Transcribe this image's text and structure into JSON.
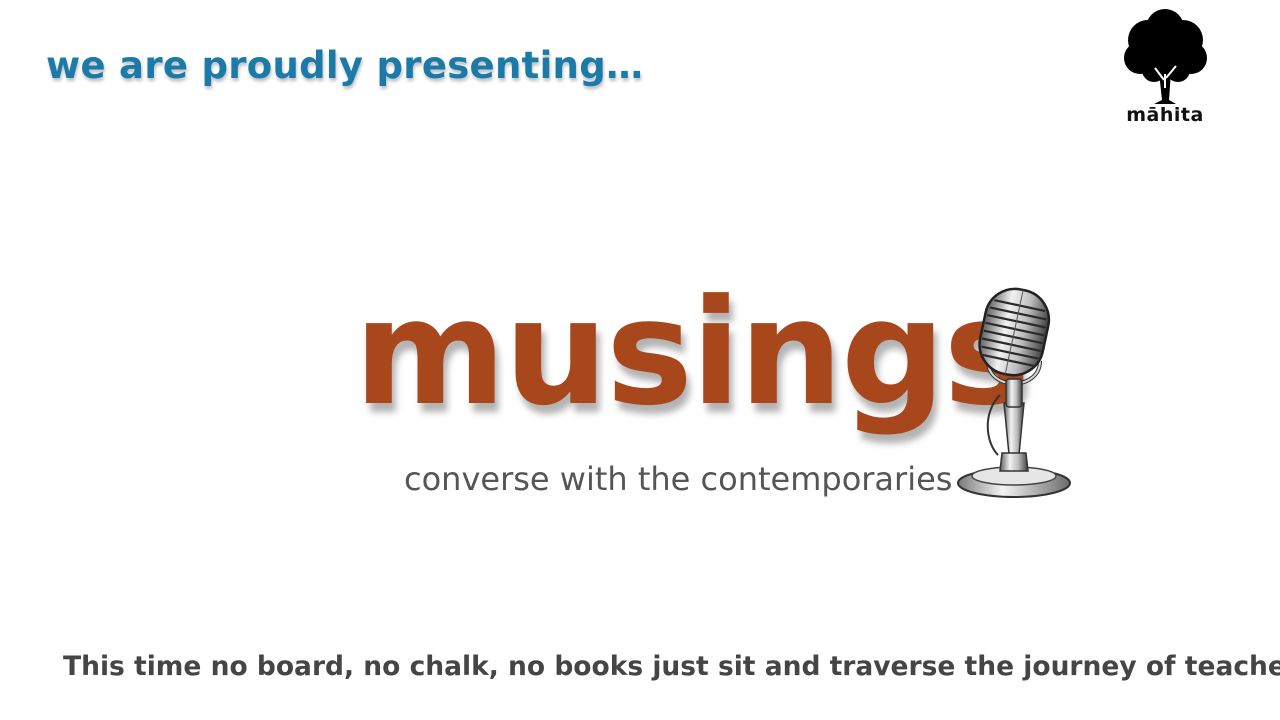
{
  "header": {
    "intro_text": "we are proudly presenting…"
  },
  "logo": {
    "name": "māhita",
    "icon": "tree-icon"
  },
  "hero": {
    "title": "musings",
    "tagline": "converse with the contemporaries",
    "icon": "microphone-icon"
  },
  "footer": {
    "text": "This time no board, no chalk, no books just sit and traverse the journey of teachers"
  },
  "colors": {
    "intro": "#1b7aa8",
    "title": "#a9471c",
    "tagline": "#555555",
    "footer": "#454545"
  }
}
